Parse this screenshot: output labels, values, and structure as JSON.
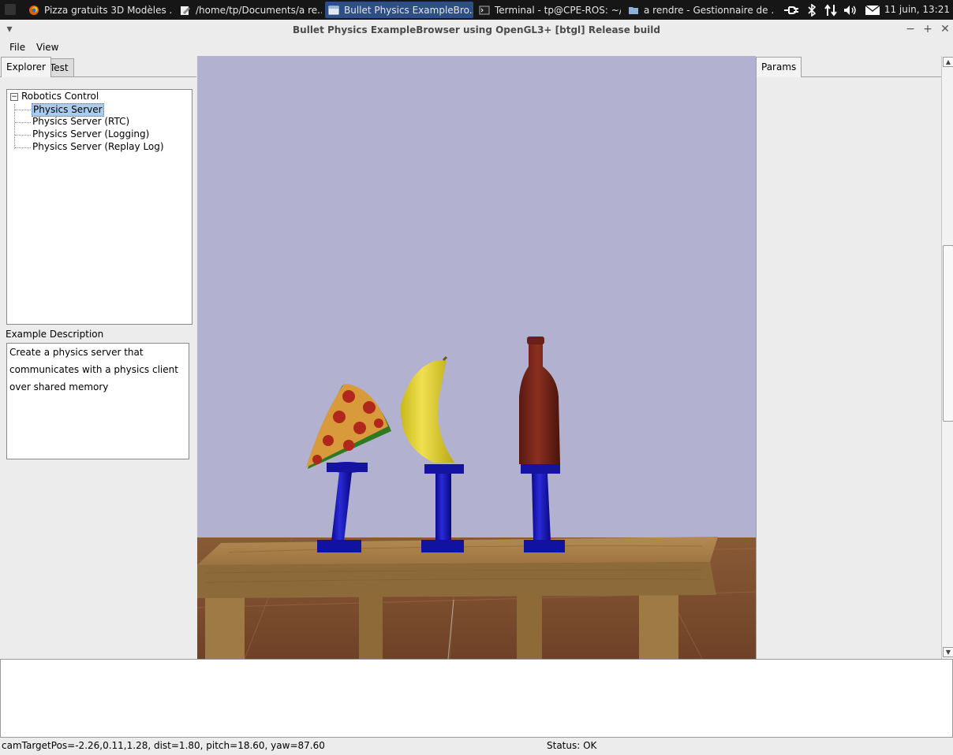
{
  "taskbar": {
    "tasks": [
      {
        "label": "Pizza gratuits 3D Modèles ...",
        "icon": "firefox-icon"
      },
      {
        "label": "/home/tp/Documents/a re...",
        "icon": "text-editor-icon"
      },
      {
        "label": "Bullet Physics ExampleBro...",
        "icon": "window-icon"
      },
      {
        "label": "Terminal - tp@CPE-ROS: ~/...",
        "icon": "terminal-icon"
      },
      {
        "label": "a rendre - Gestionnaire de ...",
        "icon": "folder-icon"
      }
    ],
    "clock": "11 juin, 13:21"
  },
  "window": {
    "title": "Bullet Physics ExampleBrowser using OpenGL3+ [btgl] Release build"
  },
  "menu": [
    "File",
    "View"
  ],
  "left_tabs": [
    "Explorer",
    "Test"
  ],
  "tree": {
    "root": "Robotics Control",
    "items": [
      "Physics Server",
      "Physics Server (RTC)",
      "Physics Server (Logging)",
      "Physics Server (Replay Log)"
    ],
    "selected_index": 0
  },
  "description": {
    "label": "Example Description",
    "lines": [
      "Create a physics server that",
      "communicates with a physics client",
      "over shared memory"
    ]
  },
  "right_tabs": [
    "Params"
  ],
  "status": {
    "camera": "camTargetPos=-2.26,0.11,1.28, dist=1.80, pitch=18.60, yaw=87.60",
    "state": "Status: OK"
  },
  "colors": {
    "sky": "#b2b1cf",
    "pedestal": "#1010a8",
    "table": "#a07a44",
    "selection": "#a8cdf0",
    "taskbar": "#161616"
  }
}
